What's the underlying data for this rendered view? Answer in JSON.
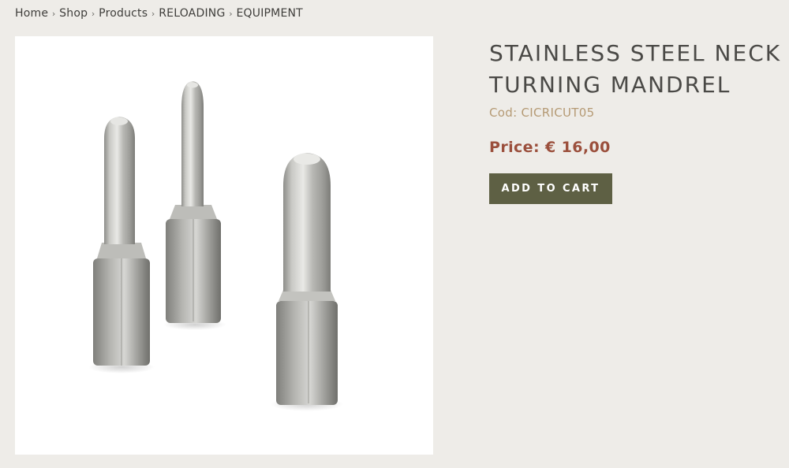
{
  "breadcrumb": {
    "items": [
      "Home",
      "Shop",
      "Products",
      "RELOADING",
      "EQUIPMENT"
    ],
    "separator": "›"
  },
  "product": {
    "title_line1": "STAINLESS STEEL NECK",
    "title_line2": "TURNING MANDREL",
    "code_label": "Cod:",
    "code": "CICRICUT05",
    "price_label": "Price:",
    "price": "€ 16,00",
    "add_to_cart_label": "ADD TO CART",
    "image_icon": "neck-turning-mandrels-image"
  },
  "colors": {
    "page_background": "#eeece8",
    "title": "#4a4946",
    "code": "#b59a74",
    "price": "#9b4f3c",
    "button_background": "#5e6044",
    "button_text": "#ffffff"
  }
}
